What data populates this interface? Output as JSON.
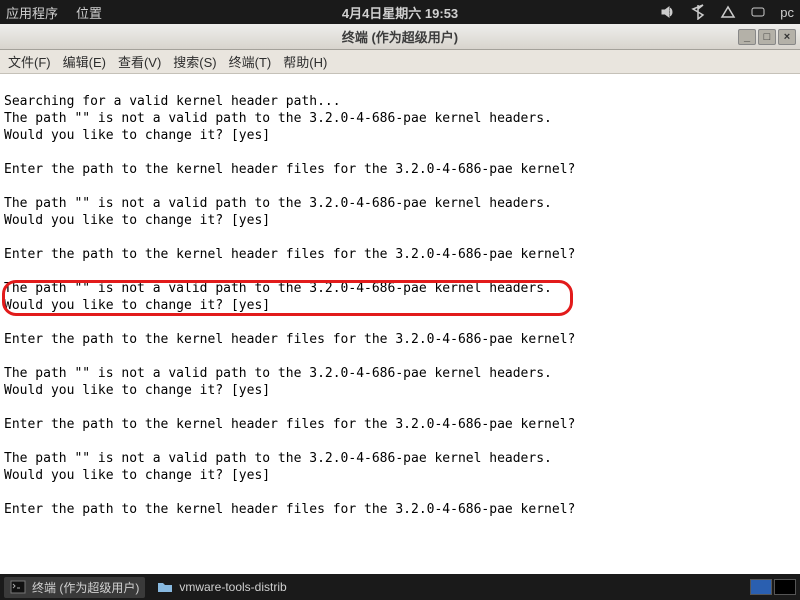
{
  "top": {
    "apps": "应用程序",
    "places": "位置",
    "datetime": "4月4日星期六 19:53",
    "vol_icon": "volume-icon",
    "bt_icon": "bluetooth-icon",
    "net_icon": "network-icon",
    "msg_icon": "message-icon",
    "user": "pc"
  },
  "titlebar": {
    "title": "终端 (作为超级用户)"
  },
  "menu": {
    "file": "文件(F)",
    "edit": "编辑(E)",
    "view": "查看(V)",
    "search": "搜索(S)",
    "terminal": "终端(T)",
    "help": "帮助(H)"
  },
  "terminal": {
    "lines": [
      "",
      "Searching for a valid kernel header path...",
      "The path \"\" is not a valid path to the 3.2.0-4-686-pae kernel headers.",
      "Would you like to change it? [yes]",
      "",
      "Enter the path to the kernel header files for the 3.2.0-4-686-pae kernel?",
      "",
      "The path \"\" is not a valid path to the 3.2.0-4-686-pae kernel headers.",
      "Would you like to change it? [yes]",
      "",
      "Enter the path to the kernel header files for the 3.2.0-4-686-pae kernel?",
      "",
      "The path \"\" is not a valid path to the 3.2.0-4-686-pae kernel headers.",
      "Would you like to change it? [yes]",
      "",
      "Enter the path to the kernel header files for the 3.2.0-4-686-pae kernel?",
      "",
      "The path \"\" is not a valid path to the 3.2.0-4-686-pae kernel headers.",
      "Would you like to change it? [yes]",
      "",
      "Enter the path to the kernel header files for the 3.2.0-4-686-pae kernel?",
      "",
      "The path \"\" is not a valid path to the 3.2.0-4-686-pae kernel headers.",
      "Would you like to change it? [yes]",
      "",
      "Enter the path to the kernel header files for the 3.2.0-4-686-pae kernel?"
    ]
  },
  "bottom": {
    "task1": "终端 (作为超级用户)",
    "task2": "vmware-tools-distrib"
  }
}
